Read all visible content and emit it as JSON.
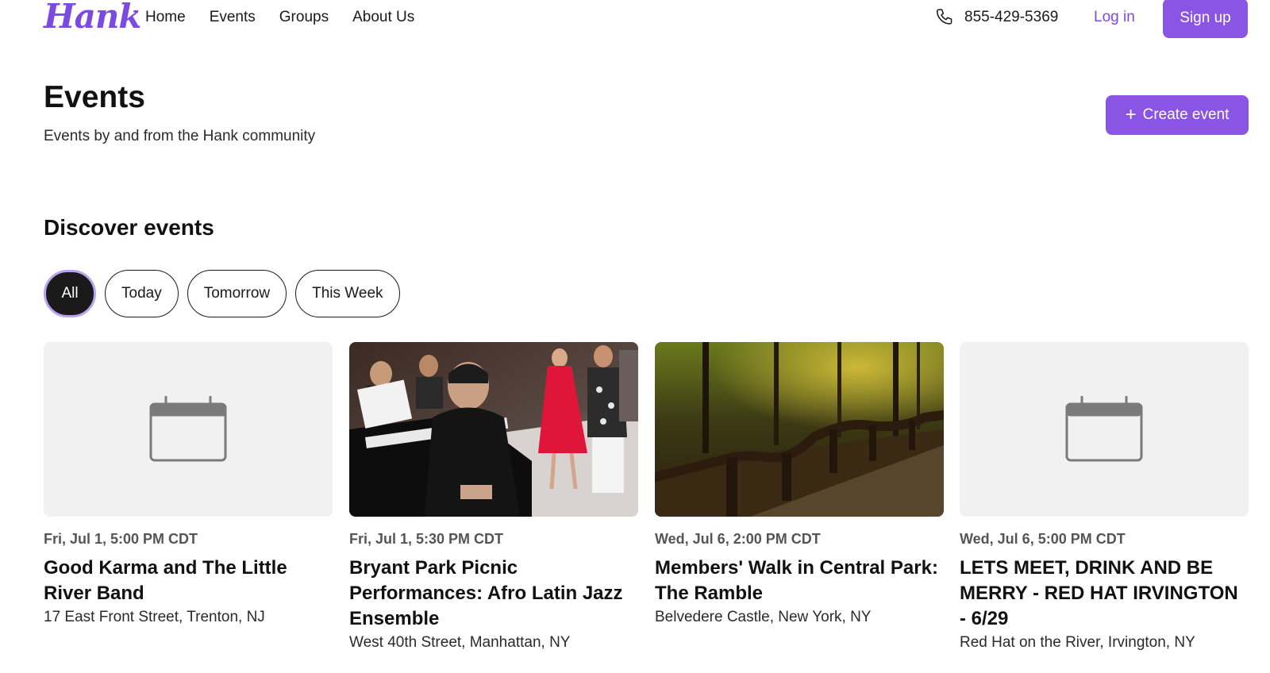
{
  "header": {
    "logo": "Hank",
    "nav": [
      "Home",
      "Events",
      "Groups",
      "About Us"
    ],
    "phone": "855-429-5369",
    "login": "Log in",
    "signup": "Sign up"
  },
  "page": {
    "title": "Events",
    "subtitle": "Events by and from the Hank community",
    "create_label": "Create event",
    "section_title": "Discover events"
  },
  "filters": [
    "All",
    "Today",
    "Tomorrow",
    "This Week"
  ],
  "cards": [
    {
      "date": "Fri, Jul 1, 5:00 PM CDT",
      "title": "Good Karma and The Little River Band",
      "location": "17 East Front Street, Trenton, NJ",
      "image": "calendar-placeholder"
    },
    {
      "date": "Fri, Jul 1, 5:30 PM CDT",
      "title": "Bryant Park Picnic Performances: Afro Latin Jazz Ensemble",
      "location": "West 40th Street, Manhattan, NY",
      "image": "jazz-photo"
    },
    {
      "date": "Wed, Jul 6, 2:00 PM CDT",
      "title": "Members' Walk in Central Park: The Ramble",
      "location": "Belvedere Castle, New York, NY",
      "image": "forest-photo"
    },
    {
      "date": "Wed, Jul 6, 5:00 PM CDT",
      "title": "LETS MEET, DRINK AND BE MERRY - RED HAT IRVINGTON - 6/29",
      "location": "Red Hat on the River, Irvington, NY",
      "image": "calendar-placeholder"
    }
  ],
  "colors": {
    "brand": "#8a55e4",
    "logo": "#7b4ae2",
    "thumb_bg": "#f1f1f1"
  }
}
